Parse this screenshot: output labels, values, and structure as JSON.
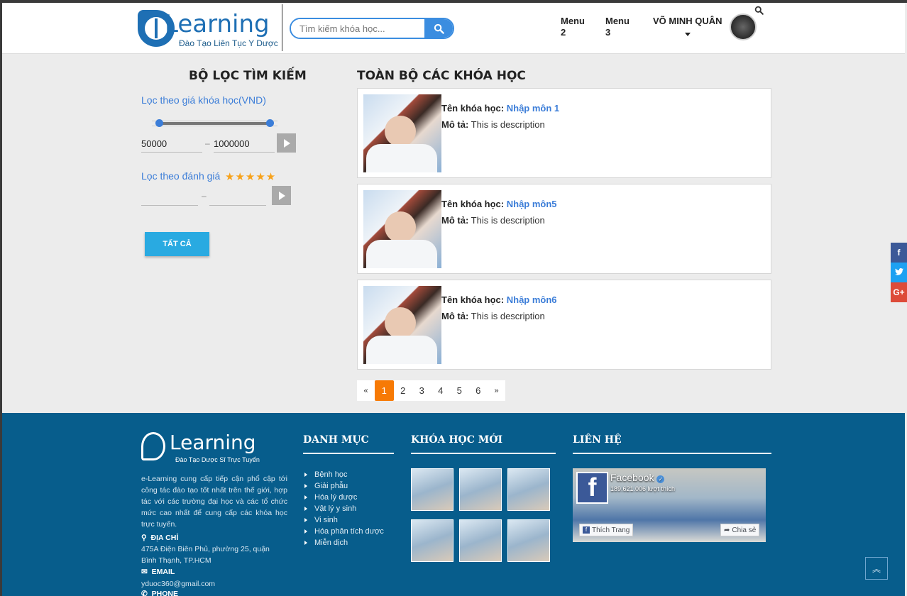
{
  "header": {
    "logo_word": "Learning",
    "logo_subtitle": "Đào Tạo Liên Tục Y Dược",
    "search_placeholder": "Tìm kiếm khóa học...",
    "menus": [
      {
        "label_line1": "Menu",
        "label_line2": "2"
      },
      {
        "label_line1": "Menu",
        "label_line2": "3"
      }
    ],
    "user_name": "VÕ MINH QUÂN"
  },
  "filter": {
    "title": "BỘ LỌC TÌM KIẾM",
    "price_label": "Lọc theo giá khóa học(VND)",
    "price_min": "50000",
    "price_max": "1000000",
    "price_range_selected_fraction": [
      0.0,
      1.0
    ],
    "dash": "–",
    "rating_label": "Lọc theo đánh giá",
    "rating_stars": "★★★★★",
    "rating_min": "",
    "rating_max": "",
    "all_button": "TẤT CẢ"
  },
  "courses": {
    "title": "TOÀN BỘ CÁC KHÓA HỌC",
    "name_label": "Tên khóa học:",
    "desc_label": "Mô tả:",
    "items": [
      {
        "name": "Nhập môn 1",
        "description": "This is description"
      },
      {
        "name": "Nhập môn5",
        "description": "This is description"
      },
      {
        "name": "Nhập môn6",
        "description": "This is description"
      }
    ]
  },
  "pagination": {
    "prev": "«",
    "next": "»",
    "pages": [
      "1",
      "2",
      "3",
      "4",
      "5",
      "6"
    ],
    "active": "1"
  },
  "social": [
    {
      "icon": "facebook-icon",
      "glyph": "f",
      "color": "#3b5998"
    },
    {
      "icon": "twitter-icon",
      "glyph": "t",
      "color": "#1da1f2"
    },
    {
      "icon": "google-plus-icon",
      "glyph": "G+",
      "color": "#dd4b39"
    }
  ],
  "footer": {
    "logo_word": "Learning",
    "logo_subtitle": "Đào Tạo Dược Sĩ Trực Tuyến",
    "about": "e-Learning cung cấp tiếp cận phổ cập tới công tác đào tạo tốt nhất trên thế giới, hợp tác với các trường đại học và các tổ chức mức cao nhất để cung cấp các khóa học trực tuyến.",
    "address_label": "ĐỊA CHỈ",
    "address": "475A Điện Biên Phủ, phường 25, quận Bình Thạnh, TP.HCM",
    "email_label": "EMAIL",
    "email": "yduoc360@gmail.com",
    "phone_label": "PHONE",
    "categories_title": "DANH MỤC",
    "categories": [
      "Bệnh học",
      "Giải phẫu",
      "Hóa lý dược",
      "Vật lý y sinh",
      "Vi sinh",
      "Hóa phân tích dược",
      "Miễn dịch"
    ],
    "new_courses_title": "KHÓA HỌC MỚI",
    "contact_title": "LIÊN HỆ",
    "fb_page_name": "Facebook",
    "fb_likes": "189.621.006 lượt thích",
    "fb_like_button": "Thích Trang",
    "fb_share_button": "Chia sẻ"
  },
  "colors": {
    "brand_blue": "#1e6fb4",
    "link_blue": "#3b7dd8",
    "accent_orange": "#f77a05",
    "button_cyan": "#29aae1",
    "footer_bg": "#075d8c",
    "star": "#f7a21b"
  }
}
